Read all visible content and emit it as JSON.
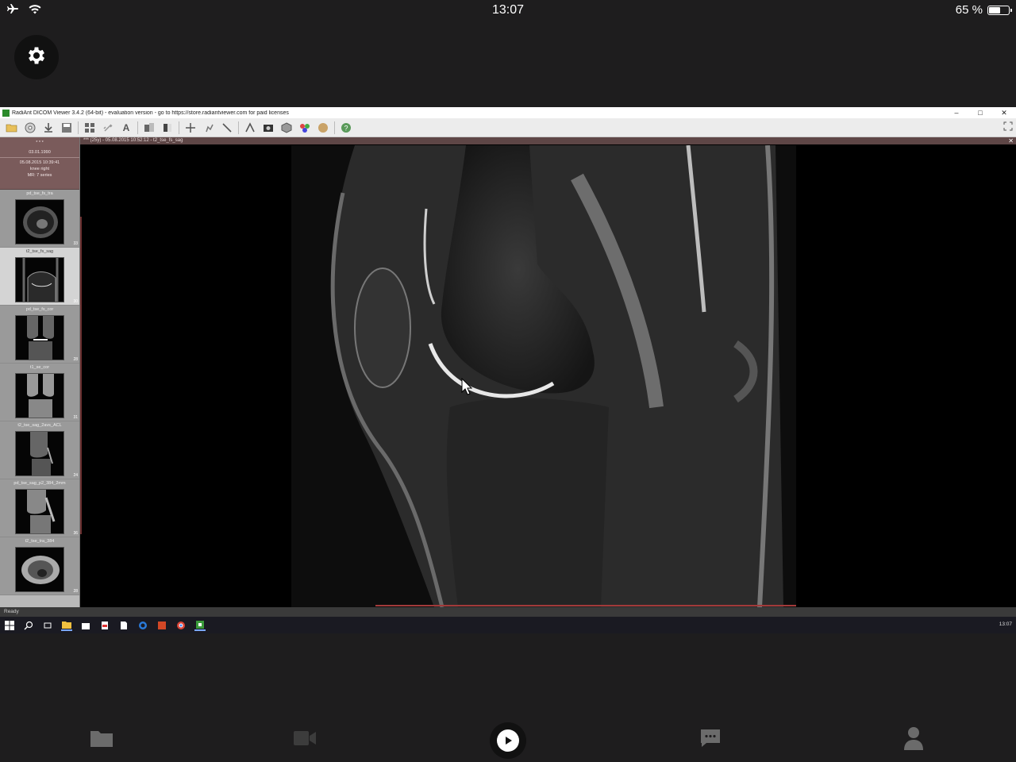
{
  "status_bar": {
    "time": "13:07",
    "battery_text": "65 %",
    "battery_level": 0.65
  },
  "app": {
    "title": "RadiAnt DICOM Viewer 3.4.2 (64-bit) - evaluation version - go to https://store.radiantviewer.com for paid licenses",
    "window_buttons": [
      "–",
      "□",
      "✕"
    ]
  },
  "patient": {
    "name": "* * *",
    "birth_date": "03.01.1990",
    "study_date": "05.08.2015 10:39:41",
    "study_desc": "knee right",
    "study_info": "MR: 7 series"
  },
  "series": [
    {
      "label": "pd_tse_fs_tra",
      "count": "33"
    },
    {
      "label": "t2_tse_fs_sag",
      "count": "30"
    },
    {
      "label": "pd_tse_fs_cor",
      "count": "28"
    },
    {
      "label": "t1_se_cor",
      "count": "31"
    },
    {
      "label": "t2_tse_sag_2avs_ACL",
      "count": "24"
    },
    {
      "label": "pd_tse_sag_p2_384_2mm",
      "count": "36"
    },
    {
      "label": "t2_tse_tra_384",
      "count": "28"
    }
  ],
  "viewer": {
    "header": "*** (25y) - 05.08.2015 10:52:12 - t2_tse_fs_sag",
    "close": "✕"
  },
  "statusline": "Ready",
  "taskbar": {
    "time": "13:07"
  },
  "icons": {
    "settings": "gear-icon",
    "folder": "folder-icon",
    "video": "video-camera-icon",
    "play": "play-icon",
    "chat": "chat-icon",
    "profile": "person-icon"
  }
}
